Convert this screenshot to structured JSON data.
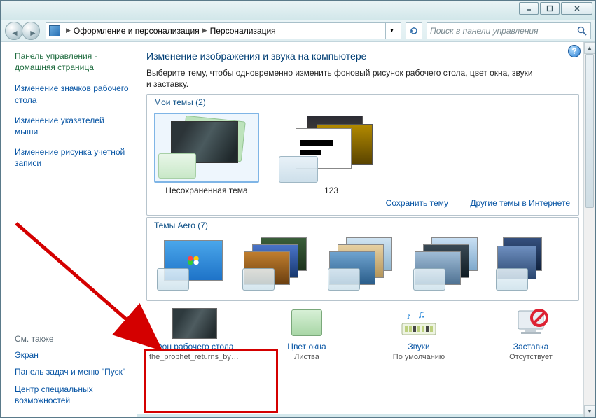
{
  "window": {
    "min": "_",
    "max": "□",
    "close": "✕"
  },
  "breadcrumb": {
    "item1": "Оформление и персонализация",
    "item2": "Персонализация"
  },
  "search": {
    "placeholder": "Поиск в панели управления"
  },
  "sidebar": {
    "head": "Панель управления - домашняя страница",
    "links": [
      "Изменение значков рабочего стола",
      "Изменение указателей мыши",
      "Изменение рисунка учетной записи"
    ],
    "seeAlsoHead": "См. также",
    "seeAlso": [
      "Экран",
      "Панель задач и меню \"Пуск\"",
      "Центр специальных возможностей"
    ]
  },
  "main": {
    "title": "Изменение изображения и звука на компьютере",
    "intro": "Выберите тему, чтобы одновременно изменить фоновый рисунок рабочего стола, цвет окна, звуки и заставку.",
    "group1": {
      "legend": "Мои темы (2)",
      "theme1": "Несохраненная тема",
      "theme2": "123",
      "saveLink": "Сохранить тему",
      "moreLink": "Другие темы в Интернете"
    },
    "group2": {
      "legend": "Темы Aero (7)"
    },
    "actions": {
      "a1": {
        "label": "Фон рабочего стола",
        "value": "the_prophet_returns_by_m..."
      },
      "a2": {
        "label": "Цвет окна",
        "value": "Листва"
      },
      "a3": {
        "label": "Звуки",
        "value": "По умолчанию"
      },
      "a4": {
        "label": "Заставка",
        "value": "Отсутствует"
      }
    }
  }
}
